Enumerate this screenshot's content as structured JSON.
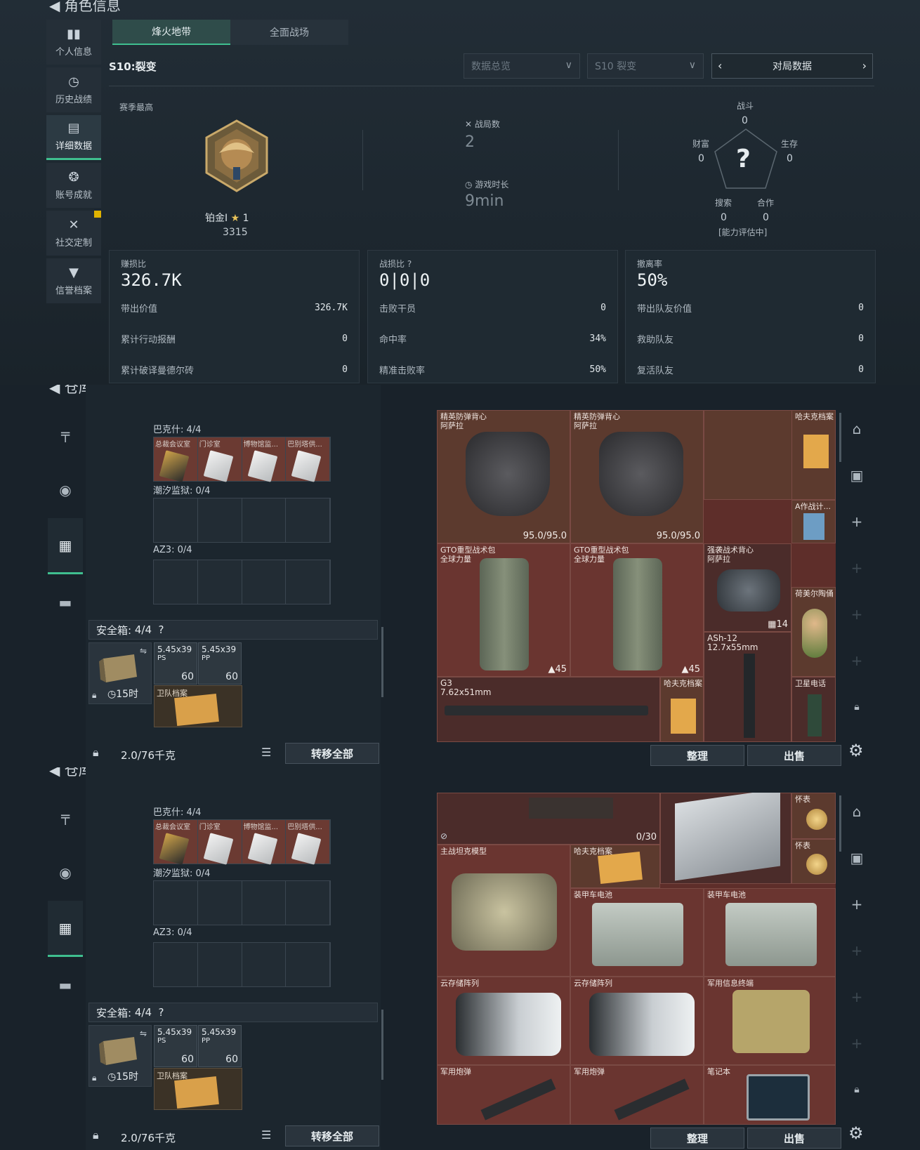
{
  "panel1": {
    "header_title": "角色信息",
    "tabs": [
      "烽火地带",
      "全面战场"
    ],
    "sidebar": [
      {
        "label": "个人信息",
        "icon": "bar-chart-icon"
      },
      {
        "label": "历史战绩",
        "icon": "clock-icon"
      },
      {
        "label": "详细数据",
        "icon": "folder-icon"
      },
      {
        "label": "账号成就",
        "icon": "trophy-icon"
      },
      {
        "label": "社交定制",
        "icon": "tools-icon"
      },
      {
        "label": "信誉档案",
        "icon": "shield-icon"
      }
    ],
    "season": "S10:裂变",
    "dropdowns": [
      "数据总览",
      "S10 裂变"
    ],
    "match_selector": "对局数据",
    "season_high_label": "赛季最高",
    "rank_name": "铂金I",
    "rank_stars": "1",
    "rank_score": "3315",
    "battles_label": "战局数",
    "battles_value": "2",
    "playtime_label": "游戏时长",
    "playtime_value": "9min",
    "radar": {
      "top_label": "战斗",
      "top_value": "0",
      "left_label": "财富",
      "left_value": "0",
      "right_label": "生存",
      "right_value": "0",
      "bl_label": "搜索",
      "bl_value": "0",
      "br_label": "合作",
      "br_value": "0",
      "status": "[能力评估中]",
      "center": "?"
    },
    "boxes": [
      {
        "head": "赚损比",
        "big": "326.7K",
        "rows": [
          [
            "带出价值",
            "326.7K"
          ],
          [
            "累计行动报酬",
            "0"
          ],
          [
            "累计破译曼德尔砖",
            "0"
          ]
        ]
      },
      {
        "head": "战损比",
        "big": "0|0|0",
        "rows": [
          [
            "击败干员",
            "0"
          ],
          [
            "命中率",
            "34%"
          ],
          [
            "精准击败率",
            "50%"
          ]
        ]
      },
      {
        "head": "撤离率",
        "big": "50%",
        "rows": [
          [
            "带出队友价值",
            "0"
          ],
          [
            "救助队友",
            "0"
          ],
          [
            "复活队友",
            "0"
          ]
        ]
      }
    ]
  },
  "warehouse": {
    "header_title": "仓库",
    "bakesh": "巴克什: 4/4",
    "bakesh_cells": [
      "总裁会议室",
      "门诊室",
      "博物馆监...",
      "巴别塔供..."
    ],
    "chaoxi": "潮汐监狱: 0/4",
    "az3": "AZ3: 0/4",
    "safe_label": "安全箱:",
    "safe_count": "4/4",
    "safe_timer": "15时",
    "ammo1_t": "5.45x39",
    "ammo1_sub": "PS",
    "ammo1_n": "60",
    "ammo2_t": "5.45x39",
    "ammo2_sub": "PP",
    "ammo2_n": "60",
    "guard_doc": "卫队档案",
    "weight": "2.0/76千克",
    "transfer_all": "转移全部",
    "sort": "整理",
    "sell": "出售"
  },
  "grid1": {
    "vest1_l1": "精英防弹背心",
    "vest1_l2": "阿萨拉",
    "vest1_v": "95.0/95.0",
    "vest2_l1": "精英防弹背心",
    "vest2_l2": "阿萨拉",
    "vest2_v": "95.0/95.0",
    "hafu": "哈夫克档案",
    "azhan": "A作战计...",
    "bag1_l1": "GTO重型战术包",
    "bag1_l2": "全球力量",
    "bag1_v": "45",
    "bag2_l1": "GTO重型战术包",
    "bag2_l2": "全球力量",
    "bag2_v": "45",
    "rig_l1": "强袭战术背心",
    "rig_l2": "阿萨拉",
    "rig_v": "14",
    "homer": "荷美尔陶俑",
    "ash_l1": "ASh-12",
    "ash_l2": "12.7x55mm",
    "g3_l1": "G3",
    "g3_l2": "7.62x51mm",
    "hafu2": "哈夫克档案",
    "sat": "卫星电话"
  },
  "grid2": {
    "ammo_count": "0/30",
    "watch1": "怀表",
    "watch2": "怀表",
    "tank": "主战坦克模型",
    "hafu": "哈夫克档案",
    "battery1": "装甲车电池",
    "battery2": "装甲车电池",
    "cloud1": "云存储阵列",
    "cloud2": "云存储阵列",
    "terminal": "军用信息终端",
    "shell1": "军用炮弹",
    "shell2": "军用炮弹",
    "laptop": "笔记本"
  },
  "colors": {
    "accent": "#3fbf8f",
    "item_red": "#6a3530",
    "panel": "#1f2a32"
  }
}
